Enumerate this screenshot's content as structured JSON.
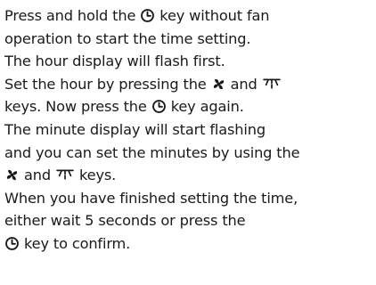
{
  "instructions": {
    "line1": {
      "pre": "Press and hold the ",
      "post": " key without fan"
    },
    "line2": "operation to start the time setting.",
    "line3": "The hour display will flash first.",
    "line4": {
      "pre": "Set the hour by pressing the ",
      "mid": " and "
    },
    "line5": {
      "pre": "keys. Now press the ",
      "post": " key again."
    },
    "line6": "The minute display will start flashing",
    "line7": "and you can set the minutes by using the",
    "line8": {
      "mid": " and ",
      "post": " keys."
    },
    "line9": "When you have finished setting the time,",
    "line10": "either wait 5 seconds or press the",
    "line11": {
      "post": " key to confirm."
    }
  },
  "icons": {
    "timer": "timer-icon",
    "fan": "fan-icon",
    "swing": "swing-icon",
    "color": "#1a1a1a"
  }
}
